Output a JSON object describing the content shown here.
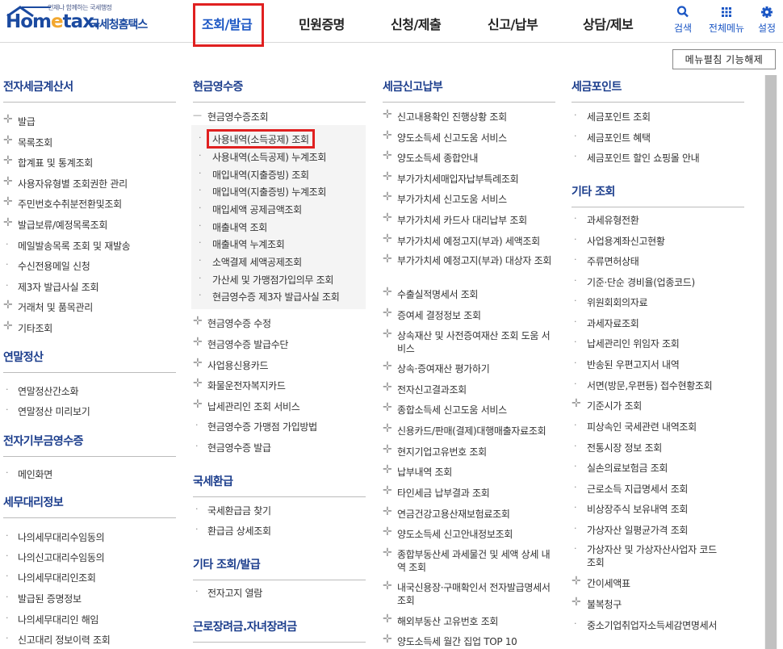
{
  "header": {
    "logo_tag": "언제나 함께하는 국세행정",
    "logo_main": "Hom",
    "logo_e": "e",
    "logo_tail": "tax.",
    "logo_kr": "국세청홈택스",
    "nav": [
      "조회/발급",
      "민원증명",
      "신청/제출",
      "신고/납부",
      "상담/제보"
    ],
    "active_nav": "조회/발급",
    "utils": [
      {
        "label": "검색",
        "icon": "search-icon"
      },
      {
        "label": "전체메뉴",
        "icon": "grid-icon"
      },
      {
        "label": "설정",
        "icon": "gear-icon"
      }
    ],
    "collapse_button": "메뉴펼침 기능해제"
  },
  "col1": {
    "sections": [
      {
        "title": "전자세금계산서",
        "items": [
          {
            "label": "발급",
            "marker": "plus"
          },
          {
            "label": "목록조회",
            "marker": "plus"
          },
          {
            "label": "합계표 및 통계조회",
            "marker": "plus"
          },
          {
            "label": "사용자유형별 조회권한 관리",
            "marker": "plus"
          },
          {
            "label": "주민번호수취분전환및조회",
            "marker": "plus"
          },
          {
            "label": "발급보류/예정목록조회",
            "marker": "plus"
          },
          {
            "label": "메일발송목록 조회 및 재발송",
            "marker": "dot"
          },
          {
            "label": "수신전용메일 신청",
            "marker": "dot"
          },
          {
            "label": "제3자 발급사실 조회",
            "marker": "dot"
          },
          {
            "label": "거래처 및 품목관리",
            "marker": "plus"
          },
          {
            "label": "기타조회",
            "marker": "plus"
          }
        ]
      },
      {
        "title": "연말정산",
        "items": [
          {
            "label": "연말정산간소화",
            "marker": "dot"
          },
          {
            "label": "연말정산 미리보기",
            "marker": "dot"
          }
        ]
      },
      {
        "title": "전자기부금영수증",
        "items": [
          {
            "label": "메인화면",
            "marker": "dot"
          }
        ]
      },
      {
        "title": "세무대리정보",
        "items": [
          {
            "label": "나의세무대리수임동의",
            "marker": "dot"
          },
          {
            "label": "나의신고대리수임동의",
            "marker": "dot"
          },
          {
            "label": "나의세무대리인조회",
            "marker": "dot"
          },
          {
            "label": "발급된 증명정보",
            "marker": "dot"
          },
          {
            "label": "나의세무대리인 해임",
            "marker": "dot"
          },
          {
            "label": "신고대리 정보이력 조회",
            "marker": "dot"
          }
        ]
      }
    ]
  },
  "col2": {
    "title": "현금영수증",
    "open_item": "현금영수증조회",
    "sub_items": [
      "사용내역(소득공제) 조회",
      "사용내역(소득공제) 누계조회",
      "매입내역(지출증빙) 조회",
      "매입내역(지출증빙) 누계조회",
      "매입세액 공제금액조회",
      "매출내역 조회",
      "매출내역 누계조회",
      "소액결제 세액공제조회",
      "가산세 및 가맹점가입의무 조회",
      "현금영수증 제3자 발급사실 조회"
    ],
    "items": [
      {
        "label": "현금영수증 수정",
        "marker": "plus"
      },
      {
        "label": "현금영수증 발급수단",
        "marker": "plus"
      },
      {
        "label": "사업용신용카드",
        "marker": "plus"
      },
      {
        "label": "화물운전자복지카드",
        "marker": "plus"
      },
      {
        "label": "납세관리인 조회 서비스",
        "marker": "plus"
      },
      {
        "label": "현금영수증 가맹점 가입방법",
        "marker": "dot"
      },
      {
        "label": "현금영수증 발급",
        "marker": "dot"
      }
    ],
    "refund_title": "국세환급",
    "refund_items": [
      "국세환급금 찾기",
      "환급금 상세조회"
    ],
    "etc_title": "기타 조회/발급",
    "etc_items": [
      "전자고지 열람"
    ],
    "last_title": "근로장려금.자녀장려금"
  },
  "col3": {
    "title": "세금신고납부",
    "items": [
      {
        "label": "신고내용확인 진행상황 조회"
      },
      {
        "label": "양도소득세 신고도움 서비스"
      },
      {
        "label": "양도소득세 종합안내"
      },
      {
        "label": "부가가치세매입자납부특례조회"
      },
      {
        "label": "부가가치세 신고도움 서비스"
      },
      {
        "label": "부가가치세 카드사 대리납부 조회"
      },
      {
        "label": "부가가치세 예정고지(부과) 세액조회"
      },
      {
        "label": "부가가치세 예정고지(부과) 대상자 조회"
      },
      {
        "label": "수출실적명세서 조회"
      },
      {
        "label": "증여세 결정정보 조회"
      },
      {
        "label": "상속재산 및 사전증여재산 조회 도움 서비스"
      },
      {
        "label": "상속·증여재산 평가하기"
      },
      {
        "label": "전자신고결과조회"
      },
      {
        "label": "종합소득세 신고도움 서비스"
      },
      {
        "label": "신용카드/판매(결제)대행매출자료조회"
      },
      {
        "label": "현지기업고유번호 조회"
      },
      {
        "label": "납부내역 조회"
      },
      {
        "label": "타인세금 납부결과 조회"
      },
      {
        "label": "연금건강고용산재보험료조회"
      },
      {
        "label": "양도소득세 신고안내정보조회"
      },
      {
        "label": "종합부동산세 과세물건 및 세액 상세 내역 조회"
      },
      {
        "label": "내국신용장·구매확인서 전자발급명세서 조회"
      },
      {
        "label": "해외부동산 고유번호 조회"
      },
      {
        "label": "양도소득세 월간 집업 TOP 10"
      }
    ]
  },
  "col4": {
    "title": "세금포인트",
    "items": [
      "세금포인트 조회",
      "세금포인트 혜택",
      "세금포인트 할인 쇼핑몰 안내"
    ],
    "etc_title": "기타 조회",
    "etc_items": [
      {
        "label": "과세유형전환",
        "marker": "dot"
      },
      {
        "label": "사업용계좌신고현황",
        "marker": "dot"
      },
      {
        "label": "주류면허상태",
        "marker": "dot"
      },
      {
        "label": "기준·단순 경비율(업종코드)",
        "marker": "dot"
      },
      {
        "label": "위원회회의자료",
        "marker": "dot"
      },
      {
        "label": "과세자료조회",
        "marker": "dot"
      },
      {
        "label": "납세관리인 위임자 조회",
        "marker": "dot"
      },
      {
        "label": "반송된 우편고지서 내역",
        "marker": "dot"
      },
      {
        "label": "서면(방문,우편등) 접수현황조회",
        "marker": "dot"
      },
      {
        "label": "기준시가 조회",
        "marker": "plus"
      },
      {
        "label": "피상속인 국세관련 내역조회",
        "marker": "dot"
      },
      {
        "label": "전통시장 정보 조회",
        "marker": "dot"
      },
      {
        "label": "실손의료보험금 조회",
        "marker": "dot"
      },
      {
        "label": "근로소득 지급명세서 조회",
        "marker": "dot"
      },
      {
        "label": "비상장주식 보유내역 조회",
        "marker": "dot"
      },
      {
        "label": "가상자산 일평균가격 조회",
        "marker": "dot"
      },
      {
        "label": "가상자산 및 가상자산사업자 코드 조회",
        "marker": "dot"
      },
      {
        "label": "간이세액표",
        "marker": "plus"
      },
      {
        "label": "불복청구",
        "marker": "plus"
      },
      {
        "label": "중소기업취업자소득세감면명세서",
        "marker": "dot"
      }
    ]
  }
}
